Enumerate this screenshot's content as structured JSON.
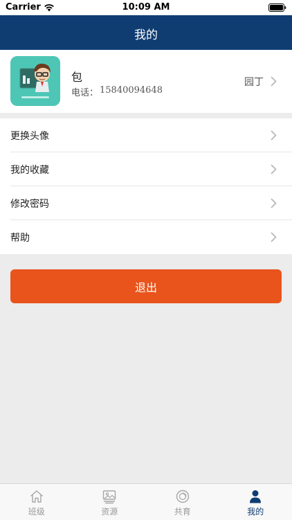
{
  "status_bar": {
    "carrier": "Carrier",
    "time": "10:09 AM"
  },
  "nav": {
    "title": "我的"
  },
  "profile": {
    "name": "包",
    "phone_label": "电话：",
    "phone": "15840094648",
    "role": "园丁",
    "avatar_icon": "teacher-cartoon-icon"
  },
  "menu": {
    "items": [
      {
        "label": "更换头像"
      },
      {
        "label": "我的收藏"
      },
      {
        "label": "修改密码"
      },
      {
        "label": "帮助"
      }
    ]
  },
  "logout": {
    "label": "退出"
  },
  "tab_bar": {
    "active_index": 3,
    "tabs": [
      {
        "label": "班级",
        "icon": "home-icon"
      },
      {
        "label": "资源",
        "icon": "resources-icon"
      },
      {
        "label": "共育",
        "icon": "co-parenting-icon"
      },
      {
        "label": "我的",
        "icon": "person-icon"
      }
    ]
  },
  "colors": {
    "nav_background": "#0f3d72",
    "logout_background": "#e8541c",
    "page_background": "#ececec",
    "tab_active": "#0f3d72",
    "tab_inactive": "#999999"
  }
}
